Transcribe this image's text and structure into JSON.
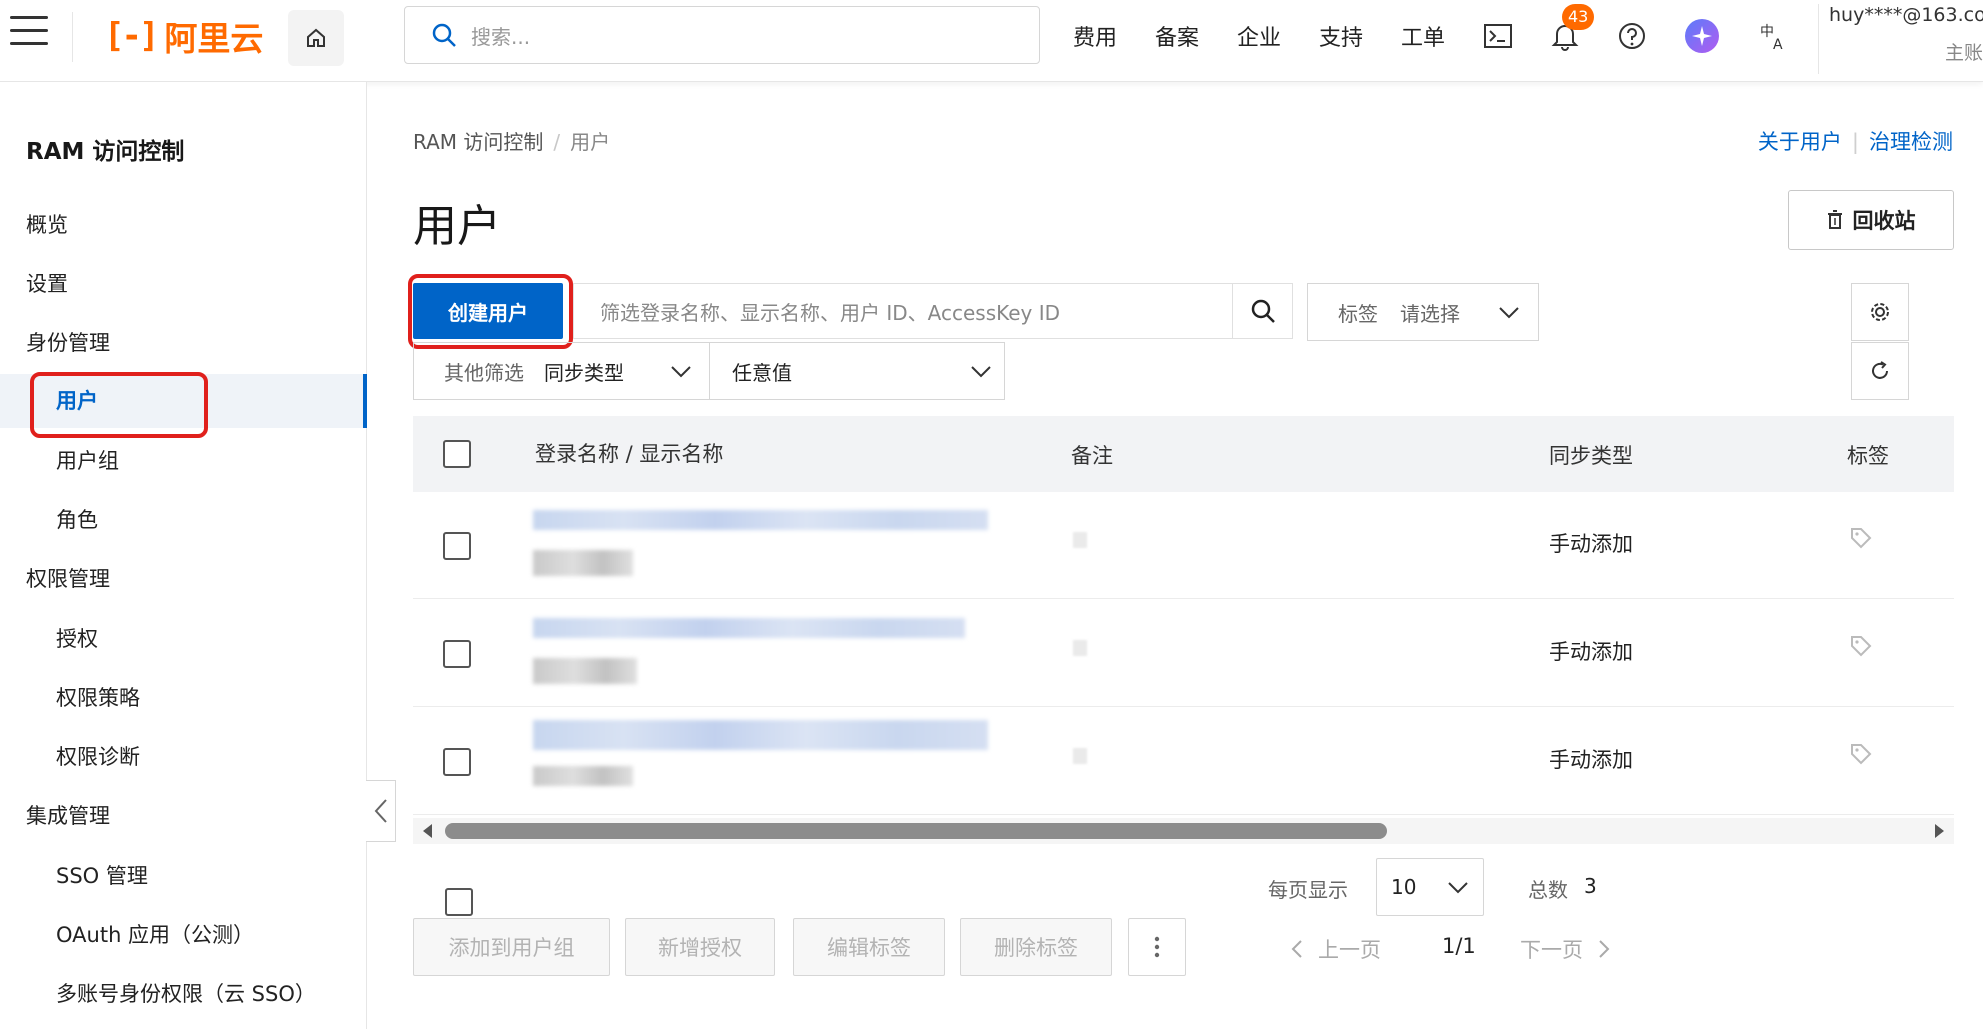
{
  "topbar": {
    "brand": "阿里云",
    "search_placeholder": "搜索...",
    "nav": [
      "费用",
      "备案",
      "企业",
      "支持",
      "工单"
    ],
    "notification_count": "43",
    "account_email": "huy****@163.co",
    "account_role": "主账"
  },
  "sidebar": {
    "title": "RAM 访问控制",
    "items": [
      {
        "label": "概览",
        "level": 1
      },
      {
        "label": "设置",
        "level": 1
      },
      {
        "label": "身份管理",
        "level": 1
      },
      {
        "label": "用户",
        "level": 2,
        "active": true
      },
      {
        "label": "用户组",
        "level": 2
      },
      {
        "label": "角色",
        "level": 2
      },
      {
        "label": "权限管理",
        "level": 1
      },
      {
        "label": "授权",
        "level": 2
      },
      {
        "label": "权限策略",
        "level": 2
      },
      {
        "label": "权限诊断",
        "level": 2
      },
      {
        "label": "集成管理",
        "level": 1
      },
      {
        "label": "SSO 管理",
        "level": 2
      },
      {
        "label": "OAuth 应用（公测）",
        "level": 2
      },
      {
        "label": "多账号身份权限（云 SSO）",
        "level": 2
      }
    ]
  },
  "breadcrumb": {
    "root": "RAM 访问控制",
    "separator": "/",
    "current": "用户"
  },
  "links": {
    "about": "关于用户",
    "governance": "治理检测"
  },
  "page_title": "用户",
  "recycle_label": "回收站",
  "toolbar": {
    "create_label": "创建用户",
    "filter_placeholder": "筛选登录名称、显示名称、用户 ID、AccessKey ID",
    "tag_label": "标签",
    "tag_placeholder": "请选择",
    "other_filter_label": "其他筛选",
    "sync_type_label": "同步类型",
    "any_value": "任意值"
  },
  "table": {
    "columns": [
      "登录名称 / 显示名称",
      "备注",
      "同步类型",
      "标签"
    ],
    "rows": [
      {
        "sync_type": "手动添加"
      },
      {
        "sync_type": "手动添加"
      },
      {
        "sync_type": "手动添加"
      }
    ]
  },
  "footer": {
    "actions": [
      "添加到用户组",
      "新增授权",
      "编辑标签",
      "删除标签"
    ],
    "per_page_label": "每页显示",
    "per_page_value": "10",
    "total_label": "总数",
    "total_value": "3",
    "prev_label": "上一页",
    "next_label": "下一页",
    "page_indicator": "1/1"
  },
  "colors": {
    "brand": "#ff6a00",
    "primary": "#0064c8",
    "highlight": "#e0201c"
  }
}
